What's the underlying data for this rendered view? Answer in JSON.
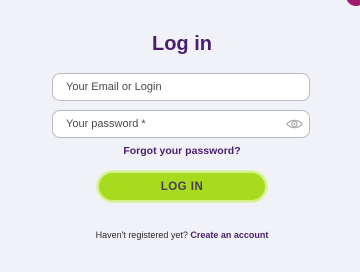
{
  "form": {
    "title": "Log in",
    "email_placeholder": "Your Email or Login",
    "password_placeholder": "Your password *",
    "forgot_link": "Forgot your password?",
    "submit_label": "LOG IN",
    "register_prompt": "Haven't registered yet?",
    "register_link": "Create an account"
  },
  "icons": {
    "password_toggle": "eye-icon"
  },
  "colors": {
    "background": "#f1f2f8",
    "title": "#4a1e6e",
    "button": "#a7dc1e",
    "corner_accent": "#a01a6e"
  }
}
